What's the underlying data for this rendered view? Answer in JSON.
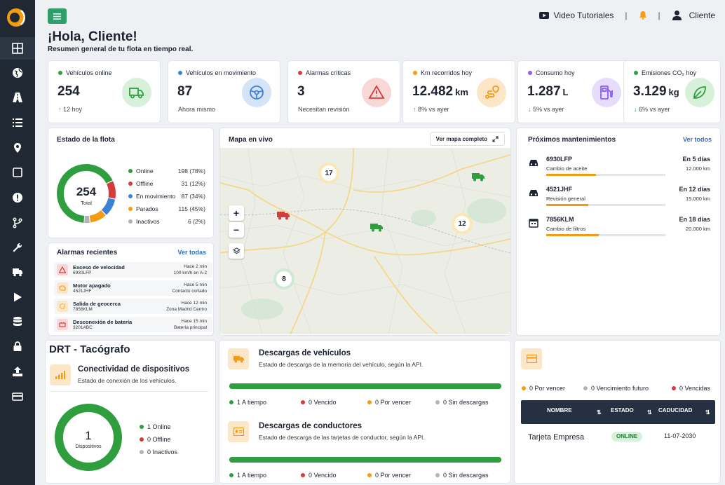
{
  "topbar": {
    "video": "Video Tutoriales",
    "user": "Cliente"
  },
  "greeting": "¡Hola, Cliente!",
  "subtitle": "Resumen general de tu flota en tiempo real.",
  "stats": [
    {
      "label": "Vehículos online",
      "value": "254",
      "unit": "",
      "foot": "12 hoy",
      "trend": "up",
      "color": "#2e9e3e"
    },
    {
      "label": "Vehículos en movimiento",
      "value": "87",
      "unit": "",
      "foot": "Ahora mismo",
      "trend": "",
      "color": "#3b82d6"
    },
    {
      "label": "Alarmas críticas",
      "value": "3",
      "unit": "",
      "foot": "Necesitan revisión",
      "trend": "",
      "color": "#d63b3b"
    },
    {
      "label": "Km recorridos hoy",
      "value": "12.482",
      "unit": "km",
      "foot": "8% vs ayer",
      "trend": "up",
      "color": "#f39c12"
    },
    {
      "label": "Consumo hoy",
      "value": "1.287",
      "unit": "L",
      "foot": "5% vs ayer",
      "trend": "down",
      "color": "#8b5cf6"
    },
    {
      "label": "Emisiones CO₂ hoy",
      "value": "3.129",
      "unit": "kg",
      "foot": "6% vs ayer",
      "trend": "down",
      "color": "#2e9e3e"
    }
  ],
  "fleet": {
    "title": "Estado de la flota",
    "total": "254",
    "total_label": "Total",
    "items": [
      {
        "label": "Online",
        "value": "198 (78%)",
        "pct": 78,
        "color": "#2e9e3e"
      },
      {
        "label": "Offline",
        "value": "31 (12%)",
        "pct": 12,
        "color": "#d63b3b"
      },
      {
        "label": "En movimiento",
        "value": "87 (34%)",
        "pct": 34,
        "color": "#3b82d6"
      },
      {
        "label": "Parados",
        "value": "115 (45%)",
        "pct": 45,
        "color": "#f39c12"
      },
      {
        "label": "Inactivos",
        "value": "6 (2%)",
        "pct": 2,
        "color": "#b0b4ba"
      }
    ]
  },
  "alarms": {
    "title": "Alarmas recientes",
    "link": "Ver todas",
    "items": [
      {
        "title": "Exceso de velocidad",
        "plate": "6930LFP",
        "time": "Hace 2 min",
        "detail": "100 km/h en A-2",
        "color": "#d63b3b"
      },
      {
        "title": "Motor apagado",
        "plate": "4521JHF",
        "time": "Hace 5 min",
        "detail": "Contacto cortado",
        "color": "#f39c12"
      },
      {
        "title": "Salida de geocerca",
        "plate": "7856KLM",
        "time": "Hace 12 min",
        "detail": "Zona Madrid Centro",
        "color": "#f39c12"
      },
      {
        "title": "Desconexión de batería",
        "plate": "3201ABC",
        "time": "Hace 15 min",
        "detail": "Batería principal",
        "color": "#d63b3b"
      }
    ]
  },
  "map": {
    "title": "Mapa en vivo",
    "full_button": "Ver mapa completo",
    "clusters": [
      "17",
      "12",
      "8"
    ]
  },
  "maintenance": {
    "title": "Próximos mantenimientos",
    "link": "Ver todos",
    "items": [
      {
        "plate": "6930LFP",
        "desc": "Cambio de aceite",
        "days": "En 5 días",
        "km": "12.000 km",
        "progress": 0.42
      },
      {
        "plate": "4521JHF",
        "desc": "Revisión general",
        "days": "En 12 días",
        "km": "15.000 km",
        "progress": 0.35
      },
      {
        "plate": "7856KLM",
        "desc": "Cambio de filtros",
        "days": "En 18 días",
        "km": "20.000 km",
        "progress": 0.44
      }
    ]
  },
  "drt": {
    "title": "DRT - Tacógrafo",
    "connectivity_title": "Conectividad de dispositivos",
    "connectivity_sub": "Estado de conexión de los vehículos.",
    "count": "1",
    "count_label": "Dispositivos",
    "legend": [
      "1 Online",
      "0 Offline",
      "0 Inactivos"
    ]
  },
  "downloads": {
    "vehicles_title": "Descargas de vehículos",
    "vehicles_sub": "Estado de descarga de la memoria del vehículo, según la API.",
    "drivers_title": "Descargas de conductores",
    "drivers_sub": "Estado de descarga de las tarjetas de conductor, según la API.",
    "vehicles_legend": [
      "1 A tiempo",
      "0 Vencido",
      "0 Por vencer",
      "0 Sin descargas"
    ],
    "drivers_legend": [
      "1 A tiempo",
      "0 Vencido",
      "0 Por vencer",
      "0 Sin descargas"
    ],
    "vehicles_on_time_fraction": 1,
    "drivers_on_time_fraction": 1
  },
  "cards": {
    "legend": [
      "0 Por vencer",
      "0 Vencimiento futuro",
      "0 Vencidas"
    ],
    "headers": [
      "NOMBRE",
      "ESTADO",
      "CADUCIDAD"
    ],
    "row": {
      "name": "Tarjeta Empresa",
      "status": "ONLINE",
      "expiry": "11-07-2030"
    }
  },
  "colors": {
    "green": "#2e9e3e",
    "red": "#d63b3b",
    "blue": "#3b82d6",
    "orange": "#f39c12",
    "gray": "#b0b4ba",
    "sidebar": "#1f2833",
    "table_header": "#253142"
  },
  "sidebar_icons": [
    "grid-icon",
    "globe-icon",
    "road-icon",
    "list-icon",
    "pin-icon",
    "square-icon",
    "alert-icon",
    "branch-icon",
    "wrench-icon",
    "truck-icon",
    "play-icon",
    "database-icon",
    "lock-icon",
    "upload-icon",
    "card-icon"
  ]
}
